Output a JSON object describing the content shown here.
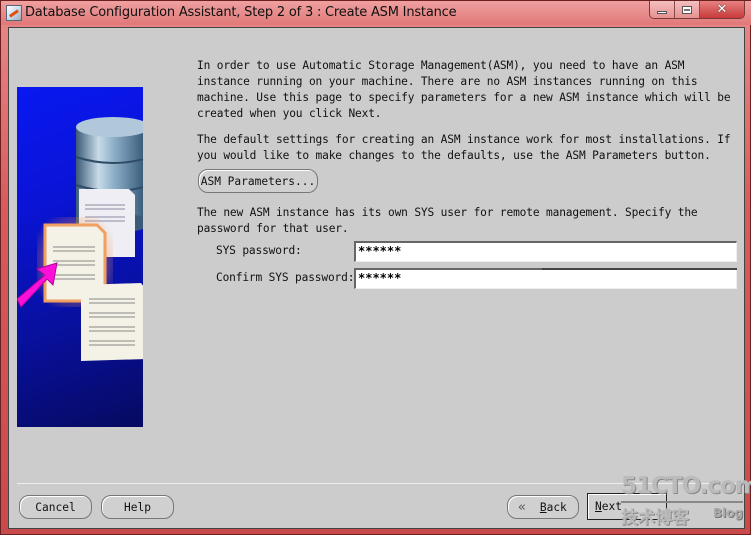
{
  "window": {
    "title": "Database Configuration Assistant, Step 2 of 3 : Create ASM Instance",
    "controls": {
      "minimize_icon": "minimize-icon",
      "maximize_icon": "maximize-icon",
      "close_icon": "close-icon",
      "close_glyph": "✕"
    }
  },
  "side_image": {
    "description": "database-cylinder-with-documents-and-pink-arrow"
  },
  "content": {
    "intro_paragraph": "In order to use Automatic Storage Management(ASM), you need to have an ASM instance running on your machine. There are no ASM instances running on this machine. Use this page to specify parameters for a new ASM instance which will be created when you click Next.",
    "defaults_paragraph": "The default settings for creating an ASM instance work for most installations. If you would like to make changes to the defaults, use the ASM Parameters button.",
    "asm_parameters_button": "ASM Parameters...",
    "sys_paragraph": "The new ASM instance has its own SYS user for remote management. Specify the password for that user.",
    "fields": [
      {
        "label": "SYS password:",
        "value": "******"
      },
      {
        "label": "Confirm SYS password:",
        "value": "******"
      }
    ]
  },
  "footer": {
    "cancel": "Cancel",
    "help": "Help",
    "back_chevron": "«",
    "back_mnemonic": "B",
    "back_rest": "ack",
    "next_mnemonic": "N",
    "next_rest": "ext"
  },
  "watermark": {
    "site": "51CTO.com",
    "chinese": "技术博客",
    "blog": "Blog"
  }
}
